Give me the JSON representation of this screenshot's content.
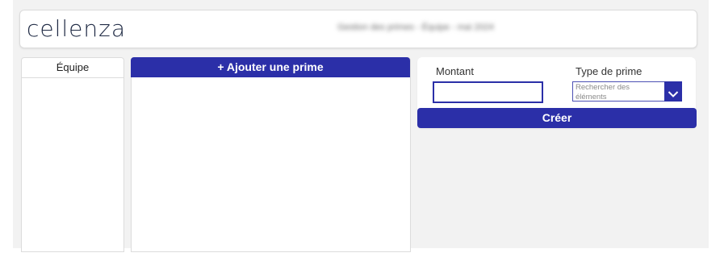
{
  "header": {
    "logo": "cellenza",
    "title": "Gestion des primes - Équipe - mai 2024"
  },
  "team_panel": {
    "title": "Équipe"
  },
  "list_panel": {
    "add_button_label": "+ Ajouter une prime"
  },
  "form": {
    "amount_label": "Montant",
    "amount_value": "",
    "type_label": "Type de prime",
    "type_placeholder": "Rechercher des éléments",
    "create_button_label": "Créer"
  },
  "colors": {
    "accent": "#2b2fa8",
    "canvas": "#f2f2f2",
    "logo": "#1f2a44"
  },
  "icons": {
    "dropdown": "chevron-down-icon"
  }
}
